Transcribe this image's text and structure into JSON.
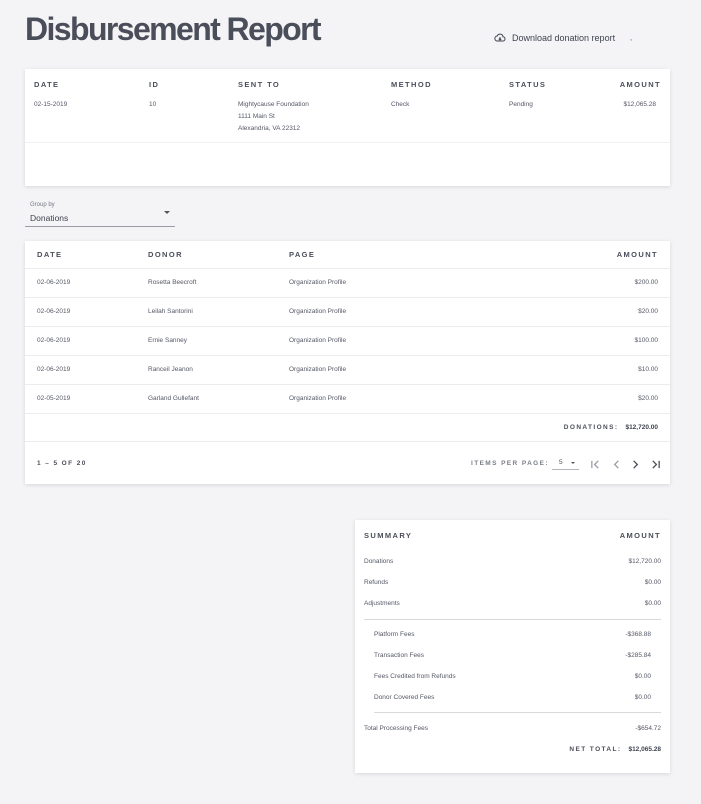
{
  "header": {
    "title": "Disbursement Report",
    "download_label": "Download donation report",
    "stray_mark": ","
  },
  "disbursement": {
    "columns": [
      "DATE",
      "ID",
      "SENT TO",
      "METHOD",
      "STATUS",
      "AMOUNT"
    ],
    "row": {
      "date": "02-15-2019",
      "id": "10",
      "sent_to": [
        "Mightycause Foundation",
        "1111 Main St",
        "Alexandria, VA 22312"
      ],
      "method": "Check",
      "status": "Pending",
      "amount": "$12,065.28"
    }
  },
  "group_by": {
    "label": "Group by",
    "value": "Donations"
  },
  "donations": {
    "columns": [
      "DATE",
      "DONOR",
      "PAGE",
      "AMOUNT"
    ],
    "rows": [
      {
        "date": "02-06-2019",
        "donor": "Rosetta Beecroft",
        "page": "Organization Profile",
        "amount": "$200.00"
      },
      {
        "date": "02-06-2019",
        "donor": "Leilah Santorini",
        "page": "Organization Profile",
        "amount": "$20.00"
      },
      {
        "date": "02-06-2019",
        "donor": "Ernie Sanney",
        "page": "Organization Profile",
        "amount": "$100.00"
      },
      {
        "date": "02-06-2019",
        "donor": "Ranceil Jeanon",
        "page": "Organization Profile",
        "amount": "$10.00"
      },
      {
        "date": "02-05-2019",
        "donor": "Garland Gullefant",
        "page": "Organization Profile",
        "amount": "$20.00"
      }
    ],
    "total_label": "DONATIONS:",
    "total_value": "$12,720.00",
    "range": "1 – 5 OF 20",
    "items_per_page_label": "ITEMS PER PAGE:",
    "items_per_page": "5"
  },
  "summary": {
    "header_left": "SUMMARY",
    "header_right": "AMOUNT",
    "main": [
      {
        "label": "Donations",
        "value": "$12,720.00"
      },
      {
        "label": "Refunds",
        "value": "$0.00"
      },
      {
        "label": "Adjustments",
        "value": "$0.00"
      }
    ],
    "fees": [
      {
        "label": "Platform Fees",
        "value": "-$368.88"
      },
      {
        "label": "Transaction Fees",
        "value": "-$285.84"
      },
      {
        "label": "Fees Credited from Refunds",
        "value": "$0.00"
      },
      {
        "label": "Donor Covered Fees",
        "value": "$0.00"
      }
    ],
    "total_processing_label": "Total Processing Fees",
    "total_processing_value": "-$654.72",
    "net_label": "NET TOTAL:",
    "net_value": "$12,065.28"
  }
}
